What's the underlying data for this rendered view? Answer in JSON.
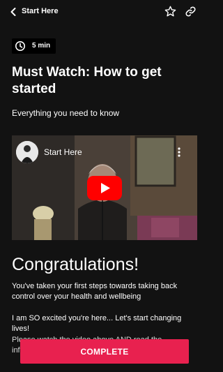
{
  "header": {
    "title": "Start Here",
    "back_icon": "chevron-left-icon",
    "favorite_icon": "star-outline-icon",
    "share_icon": "link-icon"
  },
  "lesson": {
    "duration": "5 min",
    "duration_icon": "clock-icon",
    "title": "Must Watch: How to get started",
    "subtitle": "Everything you need to know"
  },
  "video": {
    "channel_title": "Start Here",
    "menu_icon": "more-vertical-icon",
    "play_icon": "youtube-play-icon",
    "accent_color": "#ff0000"
  },
  "content": {
    "heading": "Congratulations!",
    "paragraph_1": "You've taken your first steps towards taking back control over your health and wellbeing",
    "paragraph_2": "I am SO excited you're here... Let's start changing lives!",
    "paragraph_3": "Please watch the video above AND read the information"
  },
  "actions": {
    "complete_label": "COMPLETE",
    "complete_color": "#e8214f"
  }
}
